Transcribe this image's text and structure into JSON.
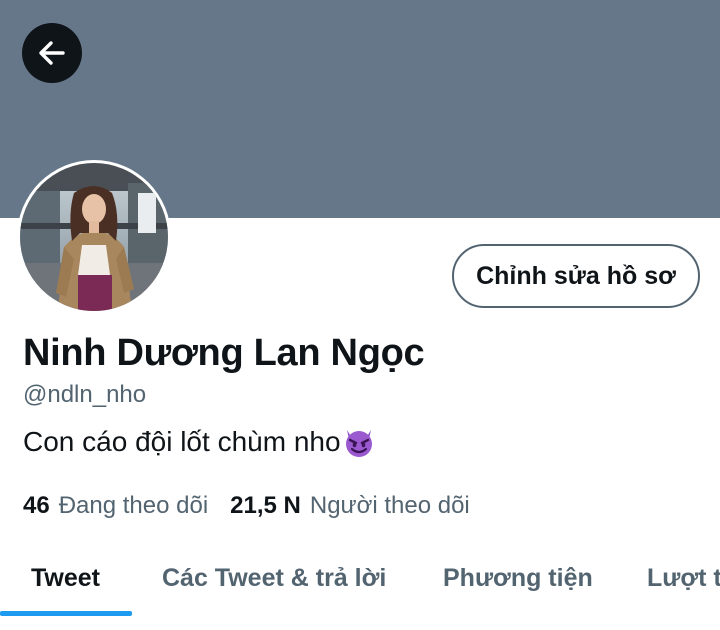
{
  "header": {
    "banner_color": "#66778a",
    "back_icon": "arrow-left-icon"
  },
  "profile": {
    "avatar_alt": "avatar",
    "edit_button_label": "Chỉnh sửa hồ sơ",
    "display_name": "Ninh Dương Lan Ngọc",
    "handle": "@ndln_nho",
    "bio": "Con cáo đội lốt chùm nho",
    "bio_emoji_icon": "smiling-devil-emoji-icon"
  },
  "stats": [
    {
      "count": "46",
      "label": "Đang theo dõi"
    },
    {
      "count": "21,5 N",
      "label": "Người theo dõi"
    }
  ],
  "tabs": [
    {
      "label": "Tweet",
      "active": true
    },
    {
      "label": "Các Tweet & trả lời",
      "active": false
    },
    {
      "label": "Phương tiện",
      "active": false
    },
    {
      "label": "Lượt thích",
      "active": false
    }
  ],
  "colors": {
    "accent": "#1d9bf0",
    "text_primary": "#0f1419",
    "text_secondary": "#536471"
  }
}
